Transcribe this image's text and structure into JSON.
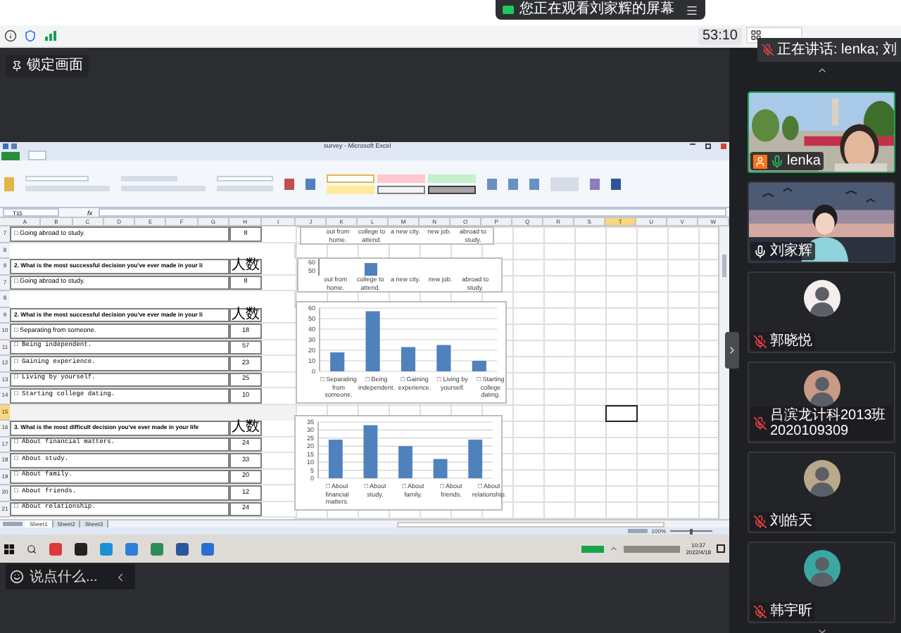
{
  "banner": {
    "text": "您正在观看刘家辉的屏幕"
  },
  "toolbar": {
    "timer": "53:10",
    "speaker_tip": "正在讲话: lenka; 刘"
  },
  "lock_button": {
    "label": "锁定画面"
  },
  "excel": {
    "title": "survey - Microsoft Excel",
    "name_box": "T15",
    "formula_label": "fx",
    "columns": [
      {
        "label": "A",
        "selected": false
      },
      {
        "label": "B",
        "selected": false
      },
      {
        "label": "C",
        "selected": false
      },
      {
        "label": "D",
        "selected": false
      },
      {
        "label": "E",
        "selected": false
      },
      {
        "label": "F",
        "selected": false
      },
      {
        "label": "G",
        "selected": false
      },
      {
        "label": "H",
        "selected": false
      },
      {
        "label": "I",
        "selected": false
      },
      {
        "label": "J",
        "selected": false
      },
      {
        "label": "K",
        "selected": false
      },
      {
        "label": "L",
        "selected": false
      },
      {
        "label": "M",
        "selected": false
      },
      {
        "label": "N",
        "selected": false
      },
      {
        "label": "O",
        "selected": false
      },
      {
        "label": "P",
        "selected": false
      },
      {
        "label": "Q",
        "selected": false
      },
      {
        "label": "R",
        "selected": false
      },
      {
        "label": "S",
        "selected": false
      },
      {
        "label": "T",
        "selected": true
      },
      {
        "label": "U",
        "selected": false
      },
      {
        "label": "V",
        "selected": false
      },
      {
        "label": "W",
        "selected": false
      }
    ],
    "rows": [
      {
        "number": "7",
        "kind": "option",
        "text": "□ Going abroad to study.",
        "count": "8",
        "monospace": false,
        "selected": false
      },
      {
        "number": "8",
        "kind": "blank",
        "selected": false
      },
      {
        "number": "9",
        "kind": "header",
        "text": "2. What is the most successful decision you've ever made in your li",
        "count": "人数",
        "selected": false
      },
      {
        "number": "7",
        "kind": "option",
        "text": "□ Going abroad to study.",
        "count": "8",
        "monospace": false,
        "selected": false
      },
      {
        "number": "8",
        "kind": "blank",
        "selected": false
      },
      {
        "number": "9",
        "kind": "header",
        "text": "2. What is the most successful decision you've ever made in your li",
        "count": "人数",
        "selected": false
      },
      {
        "number": "10",
        "kind": "option",
        "text": "□ Separating from someone.",
        "count": "18",
        "monospace": false,
        "selected": false
      },
      {
        "number": "11",
        "kind": "option",
        "text": "□ Being independent.",
        "count": "57",
        "monospace": true,
        "selected": false
      },
      {
        "number": "12",
        "kind": "option",
        "text": "□ Gaining experience.",
        "count": "23",
        "monospace": true,
        "selected": false
      },
      {
        "number": "13",
        "kind": "option",
        "text": "□ Living by yourself.",
        "count": "25",
        "monospace": true,
        "selected": false
      },
      {
        "number": "14",
        "kind": "option",
        "text": "□ Starting college dating.",
        "count": "10",
        "monospace": true,
        "selected": false
      },
      {
        "number": "15",
        "kind": "blank",
        "selected": true
      },
      {
        "number": "16",
        "kind": "header",
        "text": "3. What is the most difficult decision you've ever made in your life",
        "count": "人数",
        "selected": false
      },
      {
        "number": "17",
        "kind": "option",
        "text": "□ About financial matters.",
        "count": "24",
        "monospace": true,
        "selected": false
      },
      {
        "number": "18",
        "kind": "option",
        "text": "□ About study.",
        "count": "33",
        "monospace": true,
        "selected": false
      },
      {
        "number": "19",
        "kind": "option",
        "text": "□ About family.",
        "count": "20",
        "monospace": true,
        "selected": false
      },
      {
        "number": "20",
        "kind": "option",
        "text": "□ About friends.",
        "count": "12",
        "monospace": true,
        "selected": false
      },
      {
        "number": "21",
        "kind": "option",
        "text": "□ About relationship.",
        "count": "24",
        "monospace": true,
        "selected": false
      }
    ],
    "partial_charts": [
      {
        "labels": [
          {
            "text": "out from home."
          },
          {
            "text": "college to attend."
          },
          {
            "text": "a new city."
          },
          {
            "text": "new job."
          },
          {
            "text": "abroad to study."
          }
        ]
      },
      {
        "tick_labels": [
          "60",
          "50"
        ],
        "labels": [
          {
            "text": "out from home.",
            "bar": false
          },
          {
            "text": "college to attend.",
            "bar": true
          },
          {
            "text": "a new city.",
            "bar": false
          },
          {
            "text": "new job.",
            "bar": false
          },
          {
            "text": "abroad to study.",
            "bar": false
          }
        ]
      }
    ],
    "charts": [
      {
        "chart_data": {
          "type": "bar",
          "categories": [
            "□ Separating from someone.",
            "□ Being independent.",
            "□ Gaining experience.",
            "□ Living by yourself.",
            "□ Starting college dating."
          ],
          "series": [
            {
              "color": "#4f81bd",
              "values": [
                18,
                57,
                23,
                25,
                10
              ]
            }
          ],
          "ylim": [
            0,
            60
          ],
          "yticks": [
            0,
            10,
            20,
            30,
            40,
            50,
            60
          ],
          "grid": true
        }
      },
      {
        "chart_data": {
          "type": "bar",
          "categories": [
            "□ About financial matters.",
            "□ About study.",
            "□ About family.",
            "□ About friends.",
            "□ About relationship."
          ],
          "series": [
            {
              "color": "#4f81bd",
              "values": [
                24,
                33,
                20,
                12,
                24
              ]
            }
          ],
          "ylim": [
            0,
            35
          ],
          "yticks": [
            0,
            5,
            10,
            15,
            20,
            25,
            30,
            35
          ],
          "grid": true
        }
      }
    ],
    "sheet_tabs": [
      {
        "label": "Sheet1",
        "selected": true
      },
      {
        "label": "Sheet2",
        "selected": false
      },
      {
        "label": "Sheet3",
        "selected": false
      }
    ],
    "zoom": "100%",
    "zoom_slider": {
      "level": 0.5
    }
  },
  "taskbar": {
    "time": "10:37",
    "date": "2022/4/18"
  },
  "chat_box": {
    "placeholder": "说点什么..."
  },
  "participants": [
    {
      "name": "lenka",
      "kind": "video",
      "muted": false,
      "speaking": true,
      "host": true,
      "active": true
    },
    {
      "name": "刘家辉",
      "kind": "video",
      "muted": false,
      "speaking": false,
      "host": false,
      "active": false
    },
    {
      "name": "郭晓悦",
      "kind": "avatar",
      "color": "#f4eeee",
      "muted": true,
      "speaking": false,
      "host": false,
      "active": false
    },
    {
      "name": "吕滨龙计科2013班2020109309",
      "kind": "avatar",
      "color": "#c99a86",
      "muted": true,
      "speaking": false,
      "host": false,
      "active": false
    },
    {
      "name": "刘皓天",
      "kind": "avatar",
      "color": "#b9a98a",
      "muted": true,
      "speaking": false,
      "host": false,
      "active": false
    },
    {
      "name": "韩宇昕",
      "kind": "avatar",
      "color": "#3aa7a3",
      "muted": true,
      "speaking": false,
      "host": false,
      "active": false
    }
  ]
}
